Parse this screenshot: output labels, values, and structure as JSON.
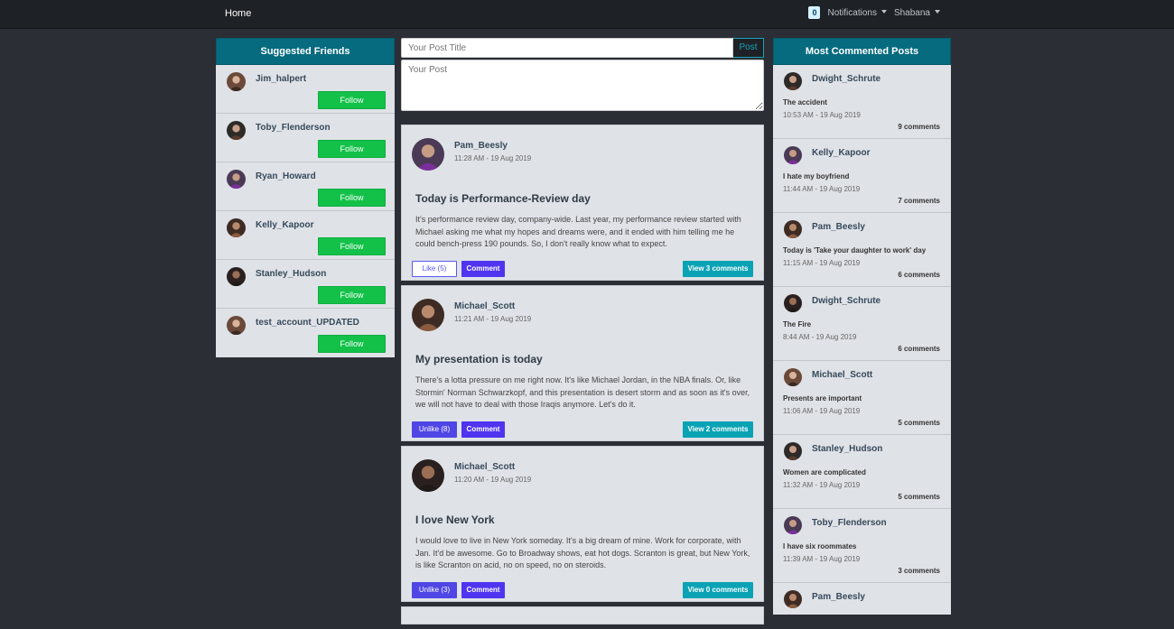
{
  "nav": {
    "home": "Home",
    "notifications_count": "0",
    "notifications_label": "Notifications",
    "user": "Shabana"
  },
  "suggested": {
    "title": "Suggested Friends",
    "follow_label": "Follow",
    "friends": [
      {
        "name": "Jim_halpert"
      },
      {
        "name": "Toby_Flenderson"
      },
      {
        "name": "Ryan_Howard"
      },
      {
        "name": "Kelly_Kapoor"
      },
      {
        "name": "Stanley_Hudson"
      },
      {
        "name": "test_account_UPDATED"
      }
    ]
  },
  "composer": {
    "title_placeholder": "Your Post Title",
    "body_placeholder": "Your Post",
    "post_label": "Post"
  },
  "posts": [
    {
      "author": "Pam_Beesly",
      "time": "11:28 AM - 19 Aug 2019",
      "title": "Today is Performance-Review day",
      "body": "It's performance review day, company-wide. Last year, my performance review started with Michael asking me what my hopes and dreams were, and it ended with him telling me he could bench-press 190 pounds. So, I don't really know what to expect.",
      "like_label": "Like (5)",
      "comment_label": "Comment",
      "view_label": "View 3 comments"
    },
    {
      "author": "Michael_Scott",
      "time": "11:21 AM - 19 Aug 2019",
      "title": "My presentation is today",
      "body": "There's a lotta pressure on me right now. It's like Michael Jordan, in the NBA finals. Or, like Stormin' Norman Schwarzkopf, and this presentation is desert storm and as soon as it's over, we will not have to deal with those Iraqis anymore. Let's do it.",
      "like_label": "Unlike (8)",
      "comment_label": "Comment",
      "view_label": "View 2 comments"
    },
    {
      "author": "Michael_Scott",
      "time": "11:20 AM - 19 Aug 2019",
      "title": "I love New York",
      "body": "I would love to live in New York someday. It's a big dream of mine. Work for corporate, with Jan. It'd be awesome. Go to Broadway shows, eat hot dogs. Scranton is great, but New York, is like Scranton on acid, no on speed, no on steroids.",
      "like_label": "Unlike (3)",
      "comment_label": "Comment",
      "view_label": "View 0 comments"
    }
  ],
  "most_commented": {
    "title": "Most Commented Posts",
    "items": [
      {
        "author": "Dwight_Schrute",
        "title": "The accident",
        "time": "10:53 AM - 19 Aug 2019",
        "count": "9 comments"
      },
      {
        "author": "Kelly_Kapoor",
        "title": "I hate my boyfriend",
        "time": "11:44 AM - 19 Aug 2019",
        "count": "7 comments"
      },
      {
        "author": "Pam_Beesly",
        "title": "Today is 'Take your daughter to work' day",
        "time": "11:15 AM - 19 Aug 2019",
        "count": "6 comments"
      },
      {
        "author": "Dwight_Schrute",
        "title": "The Fire",
        "time": "8:44 AM - 19 Aug 2019",
        "count": "6 comments"
      },
      {
        "author": "Michael_Scott",
        "title": "Presents are important",
        "time": "11:06 AM - 19 Aug 2019",
        "count": "5 comments"
      },
      {
        "author": "Stanley_Hudson",
        "title": "Women are complicated",
        "time": "11:32 AM - 19 Aug 2019",
        "count": "5 comments"
      },
      {
        "author": "Toby_Flenderson",
        "title": "I have six roommates",
        "time": "11:39 AM - 19 Aug 2019",
        "count": "3 comments"
      },
      {
        "author": "Pam_Beesly",
        "title": "",
        "time": "",
        "count": ""
      }
    ]
  }
}
